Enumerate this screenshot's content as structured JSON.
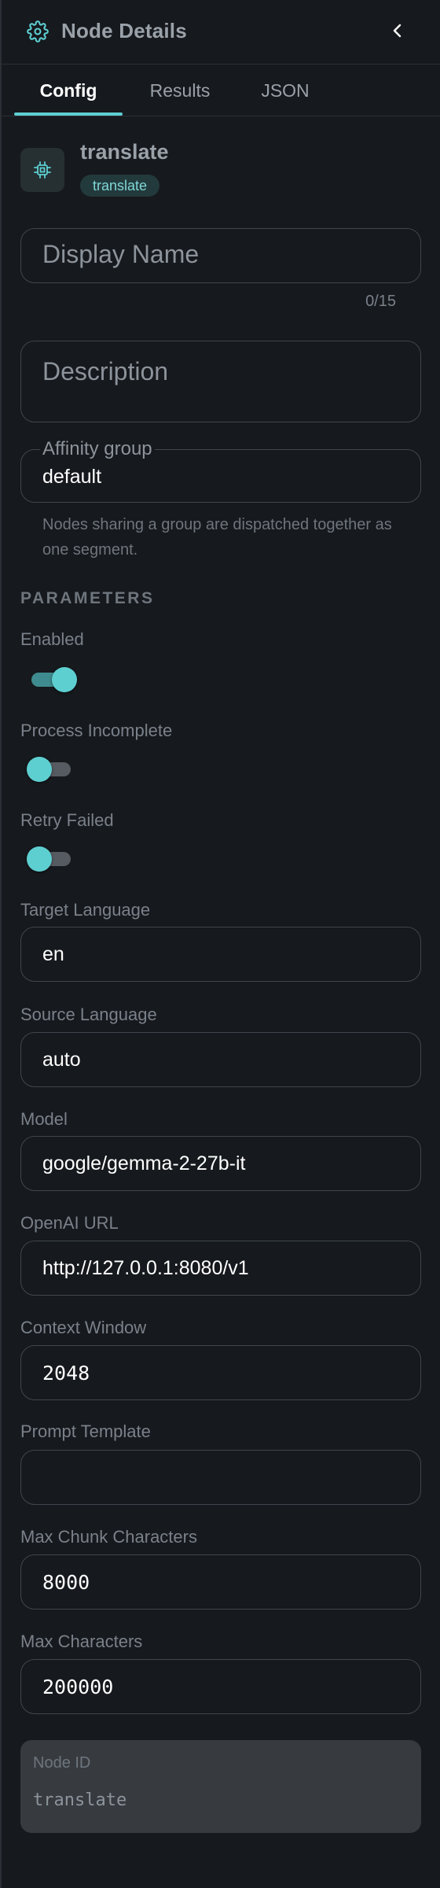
{
  "header": {
    "title": "Node Details",
    "icon": "gear-icon",
    "back_icon": "chevron-left-icon"
  },
  "tabs": [
    {
      "label": "Config",
      "active": true
    },
    {
      "label": "Results",
      "active": false
    },
    {
      "label": "JSON",
      "active": false
    }
  ],
  "node": {
    "name": "translate",
    "type_badge": "translate",
    "icon": "chip-icon"
  },
  "display_name": {
    "placeholder": "Display Name",
    "value": "",
    "counter": "0/15"
  },
  "description": {
    "placeholder": "Description",
    "value": ""
  },
  "affinity_group": {
    "label": "Affinity group",
    "value": "default",
    "helper": "Nodes sharing a group are dispatched together as one segment."
  },
  "parameters": {
    "section_title": "PARAMETERS",
    "toggles": [
      {
        "label": "Enabled",
        "on": true
      },
      {
        "label": "Process Incomplete",
        "on": false
      },
      {
        "label": "Retry Failed",
        "on": false
      }
    ],
    "fields": [
      {
        "label": "Target Language",
        "value": "en"
      },
      {
        "label": "Source Language",
        "value": "auto"
      },
      {
        "label": "Model",
        "value": "google/gemma-2-27b-it"
      },
      {
        "label": "OpenAI URL",
        "value": "http://127.0.0.1:8080/v1"
      },
      {
        "label": "Context Window",
        "value": "2048"
      },
      {
        "label": "Prompt Template",
        "value": ""
      },
      {
        "label": "Max Chunk Characters",
        "value": "8000"
      },
      {
        "label": "Max Characters",
        "value": "200000"
      }
    ]
  },
  "node_id": {
    "label": "Node ID",
    "value": "translate"
  },
  "colors": {
    "accent": "#5ecfd1",
    "background": "#16191d",
    "border": "#41474f"
  }
}
